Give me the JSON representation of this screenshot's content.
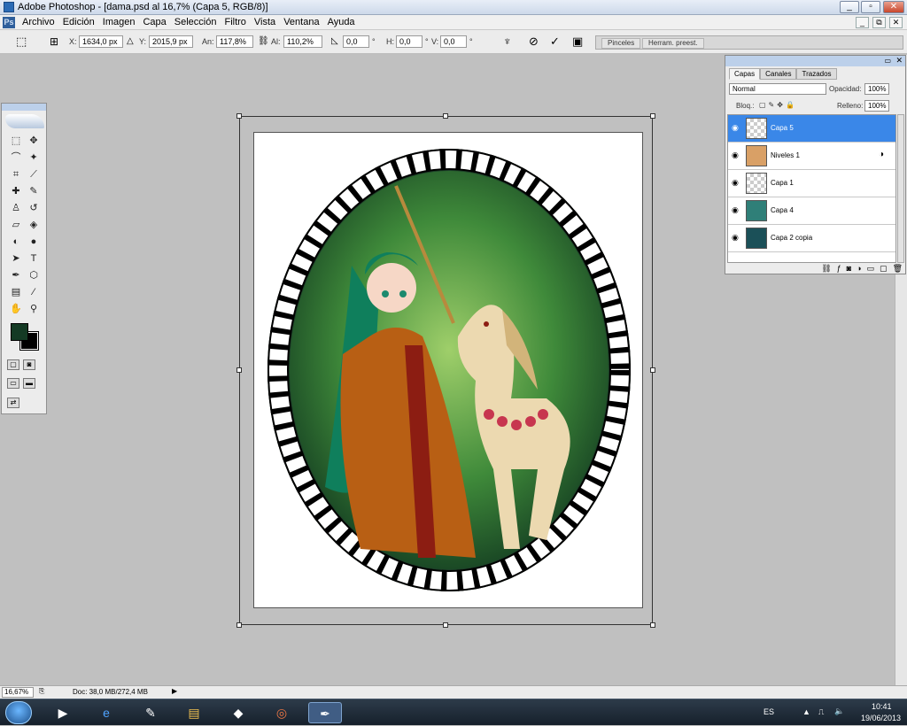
{
  "window": {
    "title": "Adobe Photoshop - [dama.psd al 16,7% (Capa 5, RGB/8)]",
    "controls": [
      "_",
      "▫",
      "✕"
    ],
    "doc_controls": [
      "_",
      "⧉",
      "✕"
    ]
  },
  "menu": {
    "app_icon": "Ps",
    "items": [
      "Archivo",
      "Edición",
      "Imagen",
      "Capa",
      "Selección",
      "Filtro",
      "Vista",
      "Ventana",
      "Ayuda"
    ]
  },
  "options": {
    "x_label": "X:",
    "x_value": "1634,0 px",
    "y_label": "Y:",
    "y_value": "2015,9 px",
    "w_label": "An:",
    "w_value": "117,8%",
    "h_label": "Al:",
    "h_value": "110,2%",
    "angle_value": "0,0",
    "hskew_label": "H:",
    "hskew_value": "0,0",
    "vskew_label": "V:",
    "vskew_value": "0,0",
    "degree": "°",
    "well_tabs": [
      "Pinceles",
      "Herram. preest."
    ]
  },
  "layers_panel": {
    "tabs": [
      "Capas",
      "Canales",
      "Trazados"
    ],
    "blend_mode": "Normal",
    "opacity_label": "Opacidad:",
    "opacity_value": "100%",
    "lock_label": "Bloq.:",
    "fill_label": "Relleno:",
    "fill_value": "100%",
    "layers": [
      {
        "name": "Capa 5",
        "active": true
      },
      {
        "name": "Niveles 1",
        "active": false
      },
      {
        "name": "Capa 1",
        "active": false
      },
      {
        "name": "Capa 4",
        "active": false
      },
      {
        "name": "Capa 2 copia",
        "active": false
      }
    ]
  },
  "status": {
    "zoom": "16,67%",
    "doc_info": "Doc: 38,0 MB/272,4 MB"
  },
  "taskbar": {
    "language": "ES",
    "time": "10:41",
    "date": "19/06/2013"
  }
}
